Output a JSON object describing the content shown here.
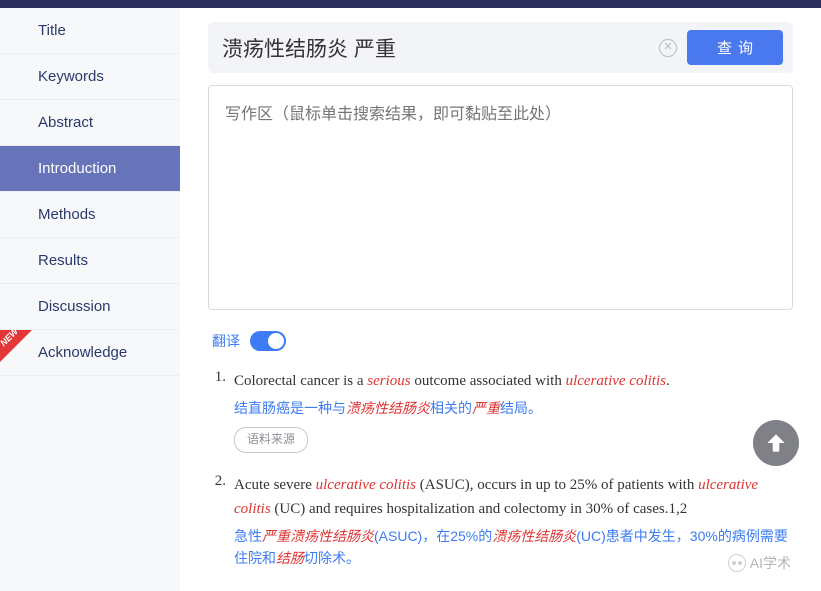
{
  "sidebar": {
    "items": [
      {
        "label": "Title",
        "active": false
      },
      {
        "label": "Keywords",
        "active": false
      },
      {
        "label": "Abstract",
        "active": false
      },
      {
        "label": "Introduction",
        "active": true
      },
      {
        "label": "Methods",
        "active": false
      },
      {
        "label": "Results",
        "active": false
      },
      {
        "label": "Discussion",
        "active": false
      },
      {
        "label": "Acknowledge",
        "active": false
      }
    ],
    "new_badge": "NEW"
  },
  "search": {
    "value": "溃疡性结肠炎 严重",
    "button": "查询"
  },
  "writing_area": {
    "placeholder": "写作区（鼠标单击搜索结果，即可黏贴至此处）"
  },
  "translate": {
    "label": "翻译",
    "on": true
  },
  "results": [
    {
      "num": "1.",
      "en_parts": [
        "Colorectal cancer is a ",
        "serious",
        " outcome associated with ",
        "ulcerative colitis",
        "."
      ],
      "zh_parts": [
        "结直肠癌是一种与",
        "溃疡性结肠炎",
        "相关的",
        "严重",
        "结局。"
      ],
      "source": "语料来源"
    },
    {
      "num": "2.",
      "en_parts": [
        "Acute severe ",
        "ulcerative colitis",
        " (ASUC), occurs in up to 25% of patients with ",
        "ulcerative colitis",
        " (UC) and requires hospitalization and colectomy in 30% of cases.1,2"
      ],
      "zh_parts": [
        "急性",
        "严重溃疡性结肠炎",
        "(ASUC)，在25%的",
        "溃疡性结肠炎",
        "(UC)患者中发生，30%的病例需要住院和",
        "结肠",
        "切除术。"
      ]
    }
  ],
  "watermark": "AI学术"
}
